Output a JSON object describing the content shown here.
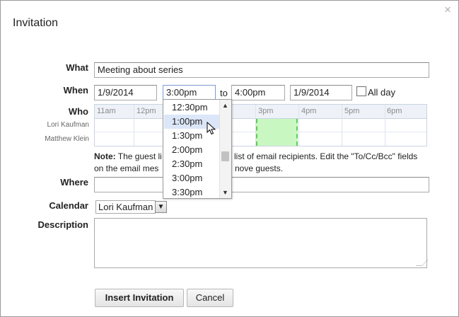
{
  "dialog": {
    "title": "Invitation",
    "close_symbol": "×"
  },
  "form": {
    "what": {
      "label": "What",
      "value": "Meeting about series"
    },
    "when": {
      "label": "When",
      "start_date": "1/9/2014",
      "start_time": "3:00pm",
      "to_label": "to",
      "end_time": "4:00pm",
      "end_date": "1/9/2014",
      "all_day_label": "All day",
      "all_day_checked": false
    },
    "who": {
      "label": "Who",
      "hours": [
        "11am",
        "12pm",
        "3pm",
        "4pm",
        "5pm",
        "6pm"
      ],
      "guests": [
        "Lori Kaufman",
        "Matthew Klein"
      ],
      "note_bold": "Note:",
      "note_line1_a": "The guest li",
      "note_line1_b": "list of email recipients. Edit the \"To/Cc/Bcc\" fields",
      "note_line2_a": "on the email mes",
      "note_line2_b": "nove guests."
    },
    "where": {
      "label": "Where",
      "value": ""
    },
    "calendar": {
      "label": "Calendar",
      "selected": "Lori Kaufman"
    },
    "description": {
      "label": "Description",
      "value": ""
    }
  },
  "time_dropdown": {
    "options": [
      "12:30pm",
      "1:00pm",
      "1:30pm",
      "2:00pm",
      "2:30pm",
      "3:00pm",
      "3:30pm"
    ],
    "highlighted": "1:00pm"
  },
  "buttons": {
    "insert": "Insert Invitation",
    "cancel": "Cancel"
  },
  "colors": {
    "selection_fill": "#c9f7c2",
    "selection_border": "#5ecb55",
    "grid_header": "#eef2f8",
    "highlight": "#dbe6f8"
  }
}
